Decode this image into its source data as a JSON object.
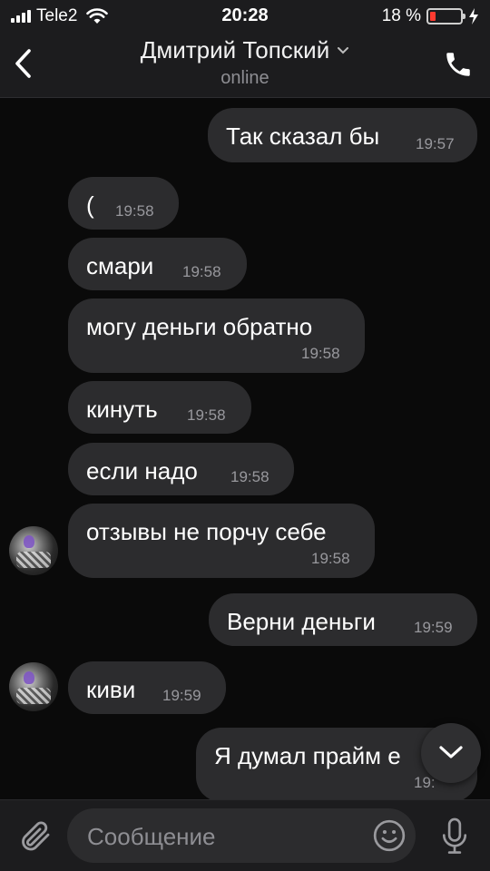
{
  "status_bar": {
    "carrier": "Tele2",
    "time": "20:28",
    "battery_percent": "18 %",
    "battery_level": 0.18,
    "signal_bars": 4,
    "icons": [
      "signal-icon",
      "wifi-icon",
      "battery-icon",
      "charging-icon"
    ]
  },
  "header": {
    "contact_name": "Дмитрий Топский",
    "status": "online",
    "icons": [
      "back-chevron-icon",
      "chevron-down-icon",
      "phone-icon"
    ]
  },
  "messages": [
    {
      "direction": "out",
      "text": "Так сказал бы",
      "time": "19:57"
    },
    {
      "direction": "in",
      "text": "(",
      "time": "19:58"
    },
    {
      "direction": "in",
      "text": "смари",
      "time": "19:58"
    },
    {
      "direction": "in",
      "text": "могу деньги обратно",
      "time": "19:58"
    },
    {
      "direction": "in",
      "text": "кинуть",
      "time": "19:58"
    },
    {
      "direction": "in",
      "text": "если надо",
      "time": "19:58"
    },
    {
      "direction": "in",
      "text": "отзывы не порчу себе",
      "time": "19:58"
    },
    {
      "direction": "out",
      "text": "Верни деньги",
      "time": "19:59"
    },
    {
      "direction": "in",
      "text": "киви",
      "time": "19:59"
    },
    {
      "direction": "out",
      "text": "Я думал прайм е",
      "time": "19:"
    }
  ],
  "composer": {
    "placeholder": "Сообщение",
    "icons": [
      "paperclip-icon",
      "emoji-icon",
      "microphone-icon",
      "scroll-down-icon"
    ]
  },
  "colors": {
    "background": "#0a0a0a",
    "bar": "#1c1c1e",
    "bubble": "#2c2c2e",
    "secondary_text": "#8e8e93",
    "battery_low": "#ff3b30"
  }
}
